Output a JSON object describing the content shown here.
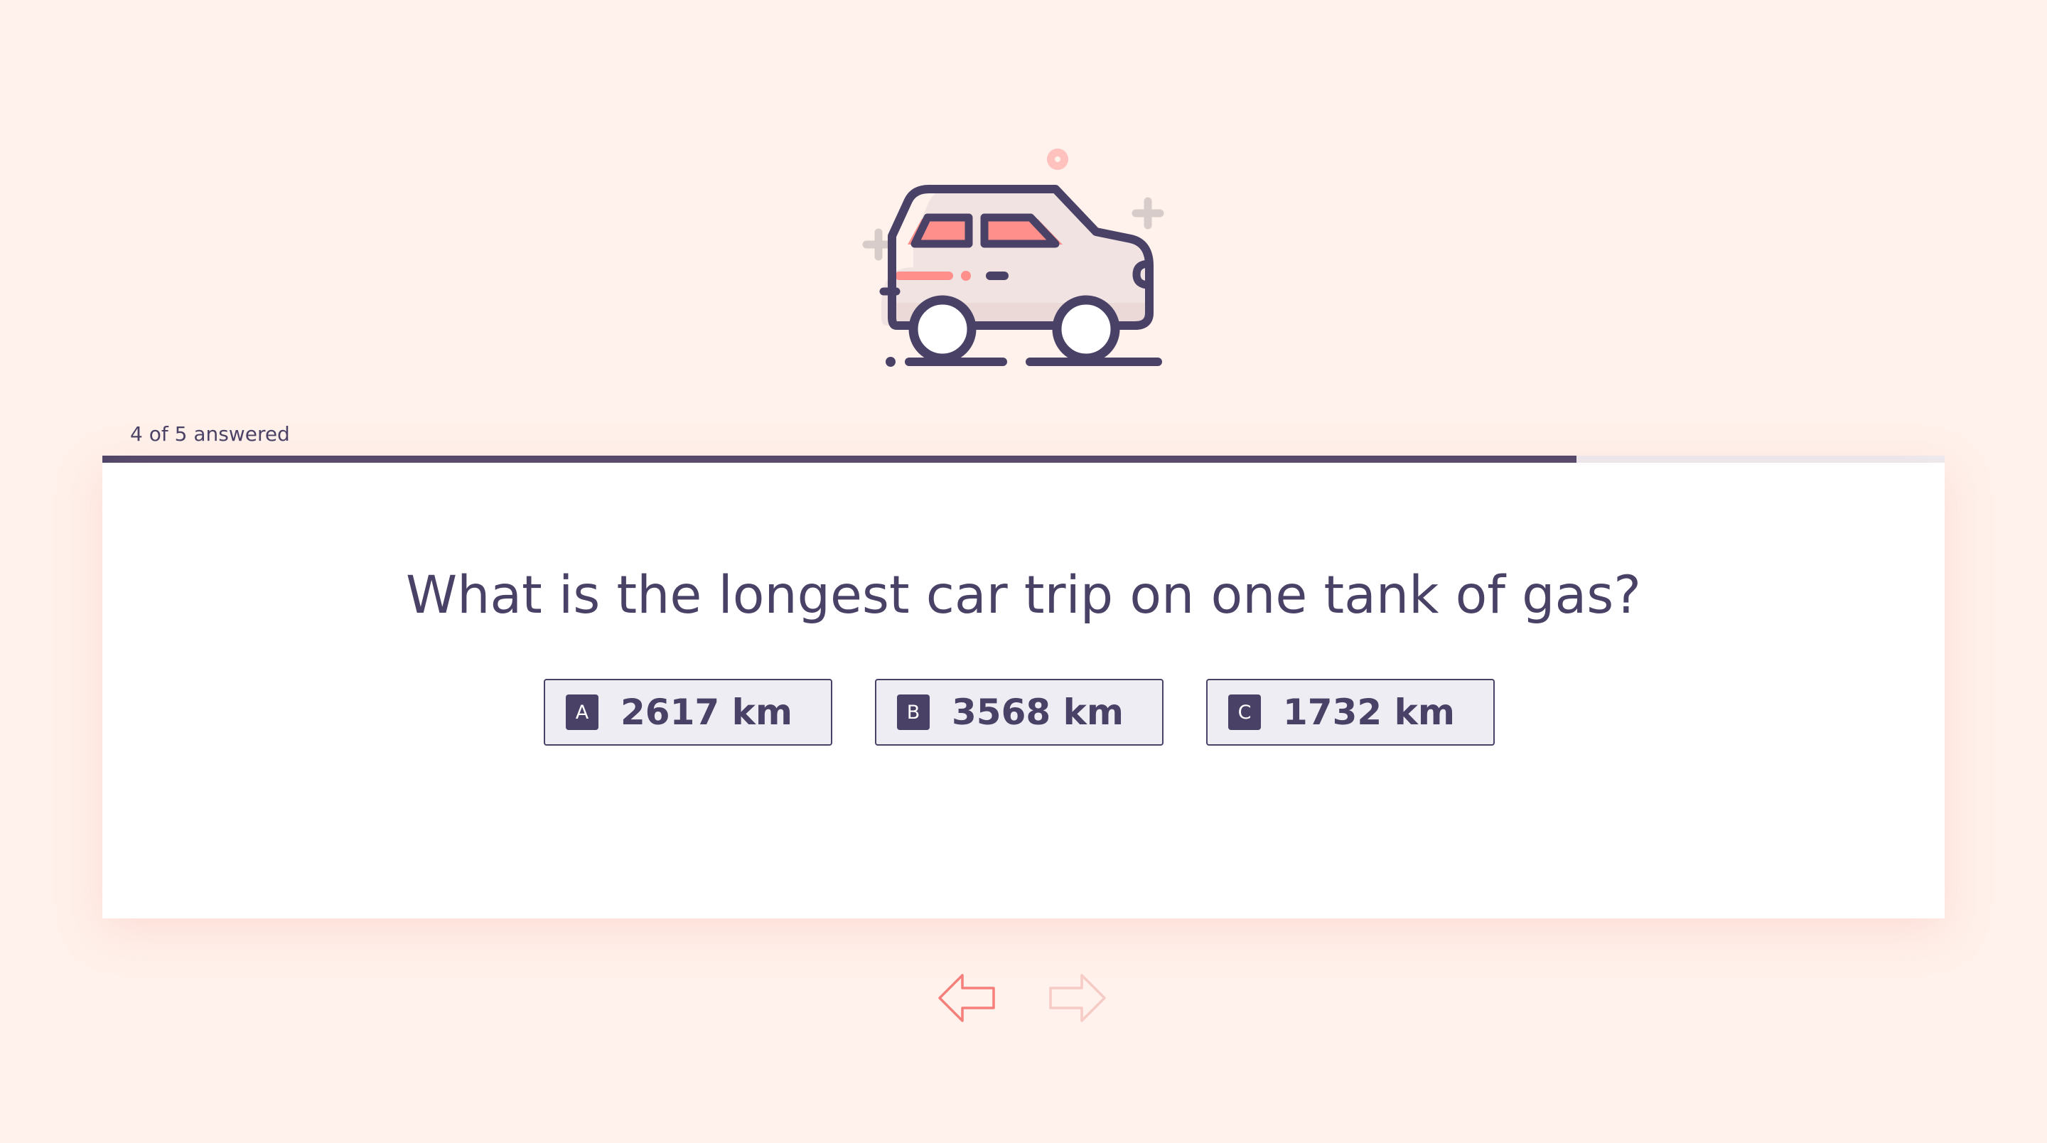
{
  "hero": {
    "icon": "car-icon",
    "colors": {
      "outline": "#4a4266",
      "accent": "#ff8f8a",
      "body_fill": "#f1e3e2",
      "sparkle": "#d8cccb"
    }
  },
  "progress": {
    "label": "4 of 5 answered",
    "answered": 4,
    "total": 5,
    "fraction": 0.8
  },
  "question": {
    "text": "What is the longest car trip on one tank of gas?",
    "answers": [
      {
        "key": "A",
        "label": "2617 km"
      },
      {
        "key": "B",
        "label": "3568 km"
      },
      {
        "key": "C",
        "label": "1732 km"
      }
    ]
  },
  "navigation": {
    "prev_icon": "arrow-left-icon",
    "next_icon": "arrow-right-icon",
    "prev_enabled": true,
    "next_enabled": false
  },
  "colors": {
    "background": "#fff1eb",
    "text": "#4a4266",
    "card": "#ffffff",
    "progress_track": "#ececf1",
    "answer_background": "#eeedf3",
    "arrow_active": "#f47f7b",
    "arrow_disabled": "#f7cbc6"
  }
}
